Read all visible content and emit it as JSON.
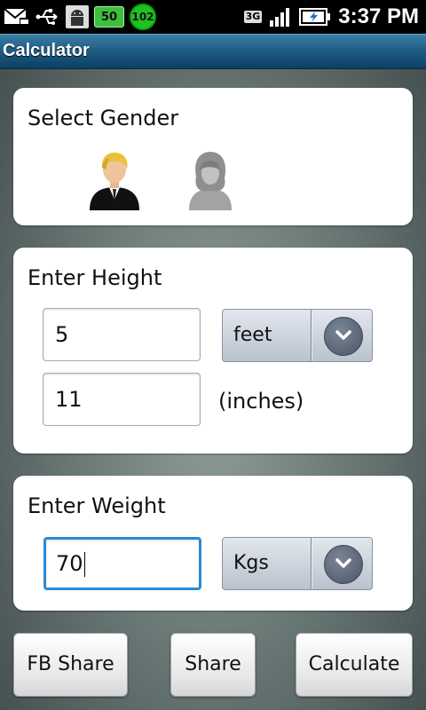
{
  "status_bar": {
    "battery_level": "50",
    "temperature": "102",
    "network": "3G",
    "time": "3:37 PM"
  },
  "app": {
    "title": "Calculator"
  },
  "gender": {
    "title": "Select Gender",
    "options": [
      {
        "name": "male",
        "selected": true
      },
      {
        "name": "female",
        "selected": false
      }
    ]
  },
  "height": {
    "title": "Enter Height",
    "feet_value": "5",
    "unit": "feet",
    "inches_value": "11",
    "inches_label": "(inches)"
  },
  "weight": {
    "title": "Enter Weight",
    "value": "70",
    "unit": "Kgs"
  },
  "buttons": {
    "fb_share": "FB Share",
    "share": "Share",
    "calculate": "Calculate"
  },
  "colors": {
    "titlebar": "#1f5e86",
    "focus": "#2a8bd6",
    "battery": "#3fbf3f"
  }
}
